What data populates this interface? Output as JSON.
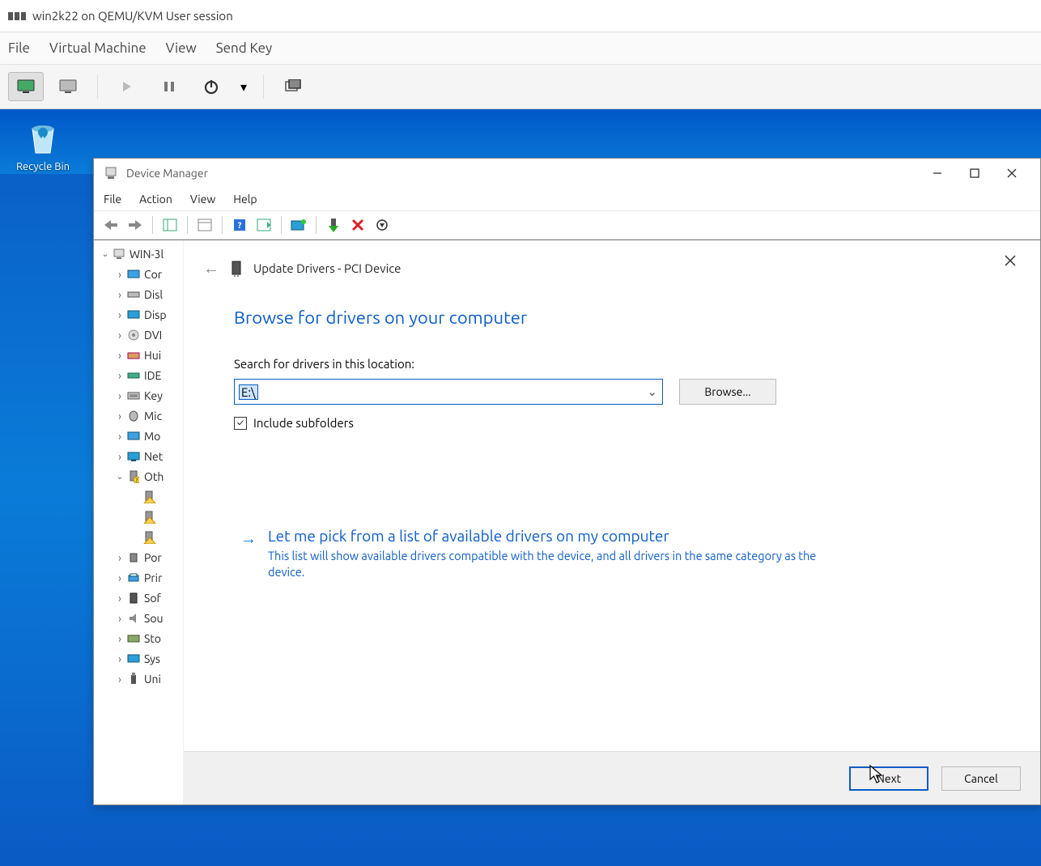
{
  "host": {
    "title": "win2k22 on QEMU/KVM User session",
    "menus": [
      "File",
      "Virtual Machine",
      "View",
      "Send Key"
    ]
  },
  "desktop": {
    "recycle_bin_label": "Recycle Bin"
  },
  "devmgr": {
    "title": "Device Manager",
    "menus": [
      "File",
      "Action",
      "View",
      "Help"
    ],
    "tree": {
      "root": "WIN-3l",
      "items": [
        "Cor",
        "Disl",
        "Disp",
        "DVI",
        "Hui",
        "IDE",
        "Key",
        "Mic",
        "Mo",
        "Net",
        "Oth",
        "Por",
        "Prir",
        "Sof",
        "Sou",
        "Sto",
        "Sys",
        "Uni"
      ]
    }
  },
  "wizard": {
    "title_prefix": "Update Drivers - PCI Device",
    "heading": "Browse for drivers on your computer",
    "search_label": "Search for drivers in this location:",
    "path_value": "E:\\",
    "browse_label": "Browse...",
    "include_subfolders_label": "Include subfolders",
    "include_subfolders_checked": true,
    "alt_title": "Let me pick from a list of available drivers on my computer",
    "alt_desc": "This list will show available drivers compatible with the device, and all drivers in the same category as the device.",
    "next_label": "Next",
    "cancel_label": "Cancel"
  }
}
